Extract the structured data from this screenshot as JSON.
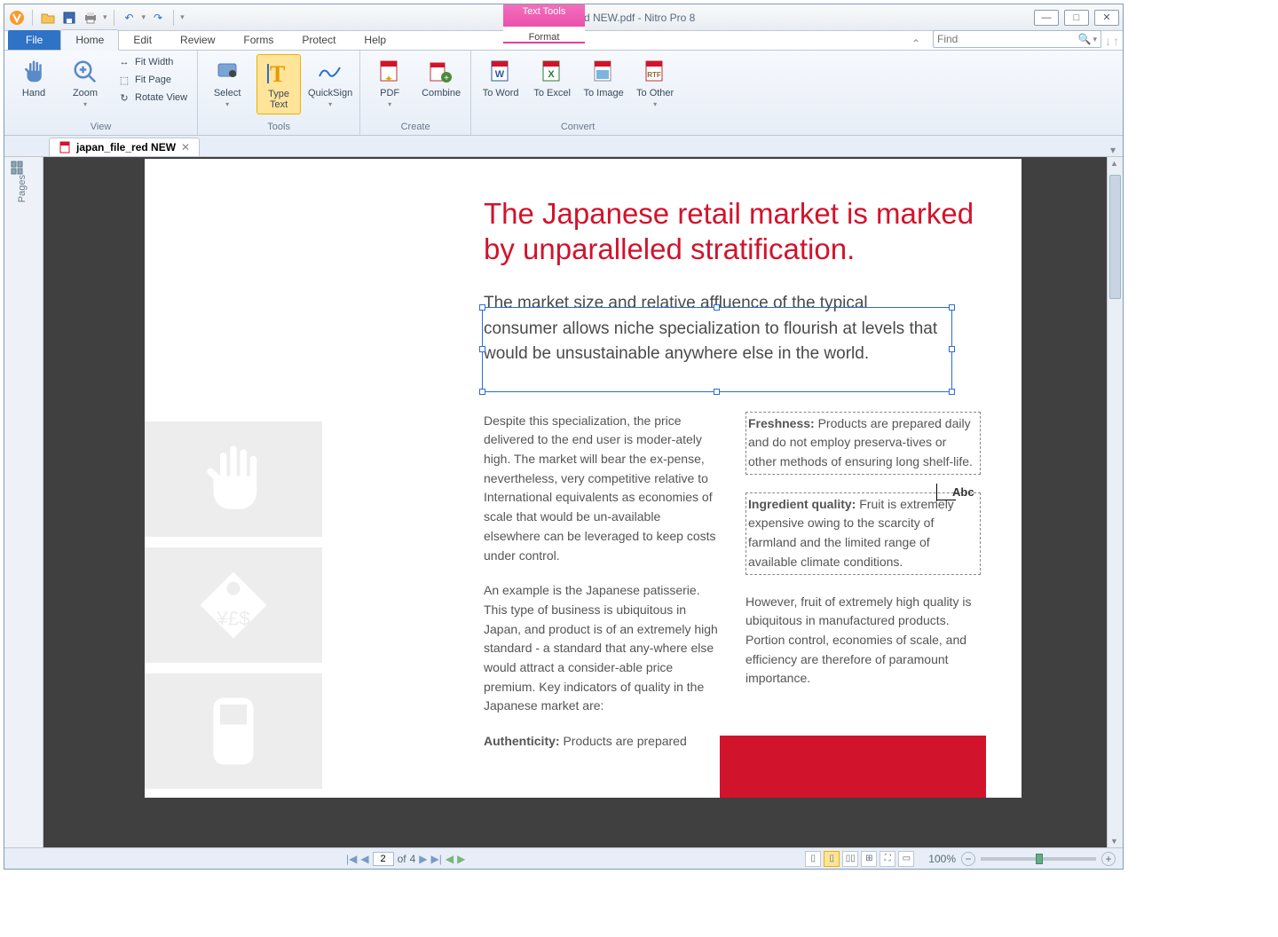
{
  "app": {
    "title": "japan_file_red NEW.pdf - Nitro Pro 8"
  },
  "contextual": {
    "header": "Text Tools",
    "tab": "Format"
  },
  "tabs": {
    "file": "File",
    "home": "Home",
    "edit": "Edit",
    "review": "Review",
    "forms": "Forms",
    "protect": "Protect",
    "help": "Help"
  },
  "find": {
    "placeholder": "Find"
  },
  "ribbon": {
    "view": {
      "title": "View",
      "hand": "Hand",
      "zoom": "Zoom",
      "fit_width": "Fit Width",
      "fit_page": "Fit Page",
      "rotate": "Rotate View"
    },
    "tools": {
      "title": "Tools",
      "select": "Select",
      "type_text": "Type Text",
      "quicksign": "QuickSign"
    },
    "create": {
      "title": "Create",
      "pdf": "PDF",
      "combine": "Combine"
    },
    "convert": {
      "title": "Convert",
      "word": "To Word",
      "excel": "To Excel",
      "image": "To Image",
      "other": "To Other"
    }
  },
  "doc_tab": {
    "name": "japan_file_red NEW"
  },
  "pages_panel": {
    "label": "Pages"
  },
  "document": {
    "heading": "The Japanese retail market is marked by unparalleled stratification.",
    "subhead": "The market size and relative affluence of the typical consumer allows niche specialization to flourish at levels that would be unsustainable anywhere else in the world.",
    "col1_p1": "Despite this specialization, the price delivered to the end user is moder-ately high. The market will bear the ex-pense, nevertheless, very competitive relative to International equivalents as economies of scale that would be un-available elsewhere can be leveraged to keep costs under control.",
    "col1_p2": "An example is the Japanese patisserie. This type of business is ubiquitous in Japan, and product  is of an extremely high standard - a standard that any-where else would attract a consider-able price premium. Key indicators of quality in the  Japanese market are:",
    "col1_p3_label": "Authenticity:",
    "col1_p3_rest": " Products are prepared",
    "col2_p1_label": "Freshness:",
    "col2_p1_rest": " Products are prepared daily and do not employ preserva-tives or other methods of ensuring long shelf-life.",
    "col2_p2_label": "Ingredient quality:",
    "col2_p2_rest": " Fruit is extremely expensive owing to the scarcity of farmland and the limited range of available climate conditions.",
    "col2_p3": "However, fruit  of extremely high quality is ubiquitous in manufactured products. Portion control, economies of scale, and efficiency are therefore of paramount importance.",
    "abc_cursor": "Abc"
  },
  "statusbar": {
    "page_current": "2",
    "page_sep": "of",
    "page_total": "4",
    "zoom": "100%"
  }
}
